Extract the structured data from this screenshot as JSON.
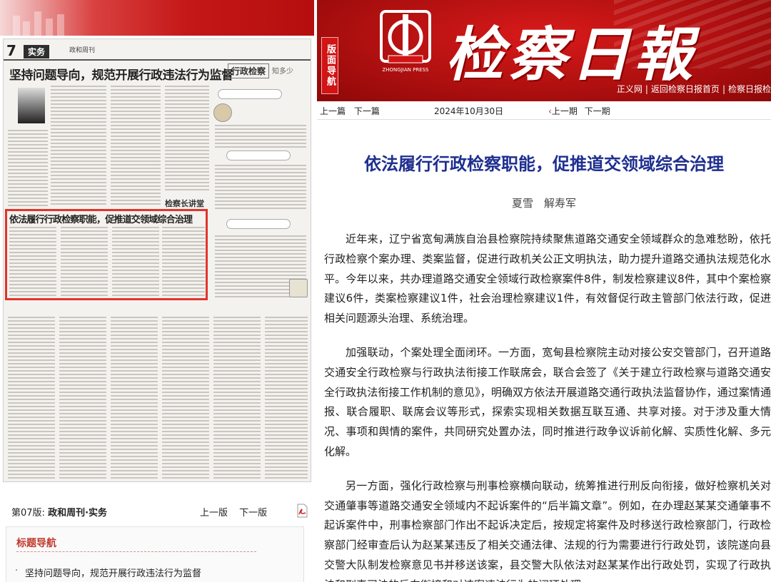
{
  "left": {
    "thumbnail": {
      "page_num": "7",
      "section_tag": "实务",
      "paper_label": "政和周刊",
      "headline": "坚持问题导向，规范开展行政违法行为监督",
      "column_name": "行政检察",
      "column_suffix": "知多少",
      "sub_column": "检察长讲堂",
      "highlighted_title": "依法履行行政检察职能，促推道交领域综合治理"
    },
    "edition_label": "第07版:",
    "edition_value": "政和周刊·实务",
    "prev_page": "上一版",
    "next_page": "下一版",
    "nav_title": "标题导航",
    "nav_items": [
      "坚持问题导向，规范开展行政违法行为监督"
    ]
  },
  "header": {
    "side_label": "版面导航",
    "logo_caption": "ZHONGJIAN PRESS",
    "title": "检察日報",
    "links": [
      "正义网",
      "返回检察日报首页",
      "检察日报检"
    ]
  },
  "subbar": {
    "prev_article": "上一篇",
    "next_article": "下一篇",
    "date": "2024年10月30日",
    "prev_issue": "上一期",
    "next_issue": "下一期"
  },
  "article": {
    "title": "依法履行行政检察职能，促推道交领域综合治理",
    "authors": "夏雪　解寿军",
    "paragraphs": [
      "近年来，辽宁省宽甸满族自治县检察院持续聚焦道路交通安全领域群众的急难愁盼，依托行政检察个案办理、类案监督，促进行政机关公正文明执法，助力提升道路交通执法规范化水平。今年以来，共办理道路交通安全领域行政检察案件8件，制发检察建议8件，其中个案检察建议6件，类案检察建议1件，社会治理检察建议1件，有效督促行政主管部门依法行政，促进相关问题源头治理、系统治理。",
      "加强联动，个案处理全面闭环。一方面，宽甸县检察院主动对接公安交管部门，召开道路交通安全行政检察与行政执法衔接工作联席会，联合会签了《关于建立行政检察与道路交通安全行政执法衔接工作机制的意见》，明确双方依法开展道路交通行政执法监督协作，通过案情通报、联合履职、联席会议等形式，探索实现相关数据互联互通、共享对接。对于涉及重大情况、事项和舆情的案件，共同研究处置办法，同时推进行政争议诉前化解、实质性化解、多元化解。",
      "另一方面，强化行政检察与刑事检察横向联动，统筹推进行刑反向衔接，做好检察机关对交通肇事等道路交通安全领域内不起诉案件的“后半篇文章”。例如，在办理赵某某交通肇事不起诉案件中，刑事检察部门作出不起诉决定后，按规定将案件及时移送行政检察部门，行政检察部门经审查后认为赵某某违反了相关交通法律、法规的行为需要进行行政处罚，该院遂向县交警大队制发检察意见书并移送该案，县交警大队依法对赵某某作出行政处罚，实现了行政执法和刑事司法的反向衔接和对该案违法行为的闭环处理。"
    ]
  }
}
